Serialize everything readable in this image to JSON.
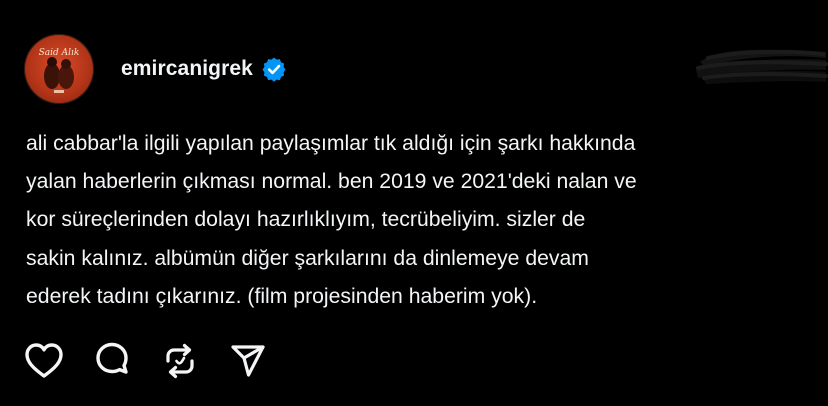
{
  "post": {
    "username": "emircanigrek",
    "verified": true,
    "avatar_text": "Said Alık",
    "caption_lines": [
      "ali cabbar'la ilgili yapılan paylaşımlar tık aldığı için şarkı hakkında",
      "yalan haberlerin çıkması normal. ben 2019 ve 2021'deki nalan ve",
      "kor süreçlerinden dolayı hazırlıklıyım, tecrübeliyim. sizler de",
      "sakin kalınız. albümün diğer şarkılarını da dinlemeye devam",
      "ederek tadını çıkarınız. (film projesinden haberim yok)."
    ]
  },
  "actions": {
    "like": "heart-icon",
    "comment": "comment-icon",
    "repost": "repost-icon",
    "share": "share-icon"
  },
  "colors": {
    "background": "#000000",
    "text": "#f3f5f7",
    "verified_badge": "#0095f6"
  }
}
